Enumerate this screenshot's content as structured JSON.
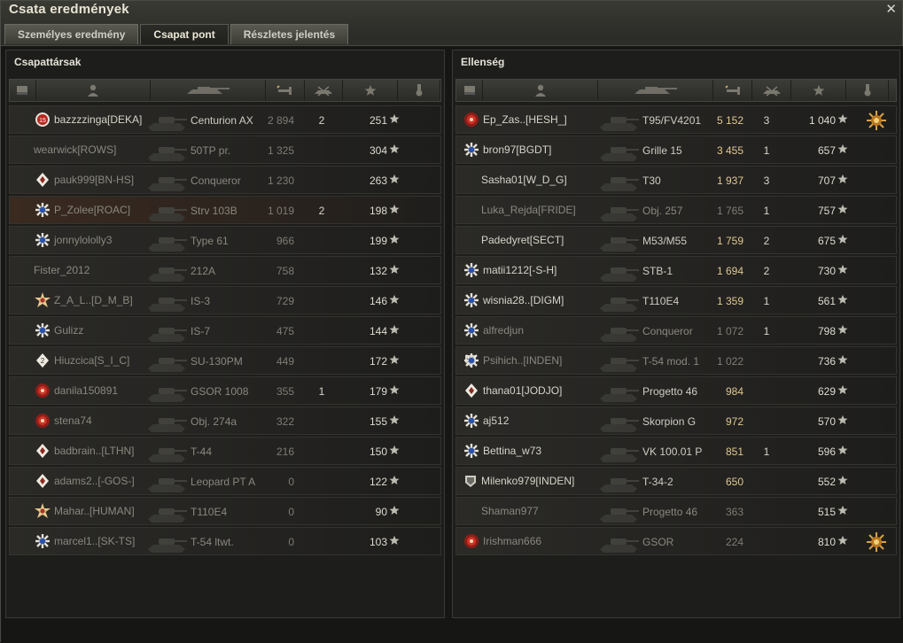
{
  "window": {
    "title": "Csata eredmények",
    "close_glyph": "✕"
  },
  "tabs": [
    {
      "label": "Személyes eredmény",
      "active": false
    },
    {
      "label": "Csapat pont",
      "active": true
    },
    {
      "label": "Részletes jelentés",
      "active": false
    }
  ],
  "allies": {
    "title": "Csapattársak",
    "rows": [
      {
        "badge": "rank-15-icon",
        "name": "bazzzzinga[DEKA]",
        "vehicle": "Centurion AX",
        "damage": "2 894",
        "kills": "2",
        "xp": "251",
        "dead": false,
        "hl": false
      },
      {
        "badge": "",
        "name": "wearwick[ROWS]",
        "vehicle": "50TP pr.",
        "damage": "1 325",
        "kills": "",
        "xp": "304",
        "dead": true,
        "hl": false
      },
      {
        "badge": "rank-diamond-icon",
        "name": "pauk999[BN-HS]",
        "vehicle": "Conqueror",
        "damage": "1 230",
        "kills": "",
        "xp": "263",
        "dead": true,
        "hl": false
      },
      {
        "badge": "rank-snowflake-icon",
        "name": "P_Zolee[ROAC]",
        "vehicle": "Strv 103B",
        "damage": "1 019",
        "kills": "2",
        "xp": "198",
        "dead": true,
        "hl": true
      },
      {
        "badge": "rank-snowflake-icon",
        "name": "jonnylololly3",
        "vehicle": "Type 61",
        "damage": "966",
        "kills": "",
        "xp": "199",
        "dead": true,
        "hl": false
      },
      {
        "badge": "",
        "name": "Fister_2012",
        "vehicle": "212A",
        "damage": "758",
        "kills": "",
        "xp": "132",
        "dead": true,
        "hl": false
      },
      {
        "badge": "rank-star-icon",
        "name": "Z_A_L..[D_M_B]",
        "vehicle": "IS-3",
        "damage": "729",
        "kills": "",
        "xp": "146",
        "dead": true,
        "hl": false
      },
      {
        "badge": "rank-snowflake-icon",
        "name": "Gulizz",
        "vehicle": "IS-7",
        "damage": "475",
        "kills": "",
        "xp": "144",
        "dead": true,
        "hl": false
      },
      {
        "badge": "rank-2-icon",
        "name": "Hiuzcica[S_I_C]",
        "vehicle": "SU-130PM",
        "damage": "449",
        "kills": "",
        "xp": "172",
        "dead": true,
        "hl": false
      },
      {
        "badge": "rank-red-icon",
        "name": "danila150891",
        "vehicle": "GSOR 1008",
        "damage": "355",
        "kills": "1",
        "xp": "179",
        "dead": true,
        "hl": false
      },
      {
        "badge": "rank-red-icon",
        "name": "stena74",
        "vehicle": "Obj. 274a",
        "damage": "322",
        "kills": "",
        "xp": "155",
        "dead": true,
        "hl": false
      },
      {
        "badge": "rank-diamond-icon",
        "name": "badbrain..[LTHN]",
        "vehicle": "T-44",
        "damage": "216",
        "kills": "",
        "xp": "150",
        "dead": true,
        "hl": false
      },
      {
        "badge": "rank-diamond-icon",
        "name": "adams2..[-GOS-]",
        "vehicle": "Leopard PT A",
        "damage": "0",
        "kills": "",
        "xp": "122",
        "dead": true,
        "hl": false
      },
      {
        "badge": "rank-star-icon",
        "name": "Mahar..[HUMAN]",
        "vehicle": "T110E4",
        "damage": "0",
        "kills": "",
        "xp": "90",
        "dead": true,
        "hl": false
      },
      {
        "badge": "rank-snowflake-icon",
        "name": "marcel1..[SK-TS]",
        "vehicle": "T-54 ltwt.",
        "damage": "0",
        "kills": "",
        "xp": "103",
        "dead": true,
        "hl": false
      }
    ]
  },
  "enemies": {
    "title": "Ellenség",
    "rows": [
      {
        "badge": "rank-red-icon",
        "name": "Ep_Zas..[HESH_]",
        "vehicle": "T95/FV4201",
        "damage": "5 152",
        "kills": "3",
        "xp": "1 040",
        "medal": true,
        "dead": false,
        "gold": true,
        "platoon": false
      },
      {
        "badge": "rank-snowflake-icon",
        "name": "bron97[BGDT]",
        "vehicle": "Grille 15",
        "damage": "3 455",
        "kills": "1",
        "xp": "657",
        "medal": false,
        "dead": false,
        "gold": true,
        "platoon": false
      },
      {
        "badge": "",
        "name": "Sasha01[W_D_G]",
        "vehicle": "T30",
        "damage": "1 937",
        "kills": "3",
        "xp": "707",
        "medal": false,
        "dead": false,
        "gold": true,
        "platoon": false
      },
      {
        "badge": "",
        "name": "Luka_Rejda[FRIDE]",
        "vehicle": "Obj. 257",
        "damage": "1 765",
        "kills": "1",
        "xp": "757",
        "medal": false,
        "dead": true,
        "gold": false,
        "platoon": false
      },
      {
        "badge": "",
        "name": "Padedyret[SECT]",
        "vehicle": "M53/M55",
        "damage": "1 759",
        "kills": "2",
        "xp": "675",
        "medal": false,
        "dead": false,
        "gold": true,
        "platoon": false
      },
      {
        "badge": "rank-snowflake-icon",
        "name": "matii1212[-S-H]",
        "vehicle": "STB-1",
        "damage": "1 694",
        "kills": "2",
        "xp": "730",
        "medal": false,
        "dead": false,
        "gold": true,
        "platoon": false
      },
      {
        "badge": "rank-snowflake-icon",
        "name": "wisnia28..[DIGM]",
        "vehicle": "T110E4",
        "damage": "1 359",
        "kills": "1",
        "xp": "561",
        "medal": false,
        "dead": false,
        "gold": true,
        "platoon": false
      },
      {
        "badge": "rank-snowflake-icon",
        "name": "alfredjun",
        "vehicle": "Conqueror",
        "damage": "1 072",
        "kills": "1",
        "xp": "798",
        "medal": false,
        "dead": true,
        "gold": false,
        "platoon": false
      },
      {
        "badge": "rank-snowflake-icon",
        "name": "Psihich..[INDEN]",
        "vehicle": "T-54 mod. 1",
        "damage": "1 022",
        "kills": "",
        "xp": "736",
        "medal": false,
        "dead": true,
        "gold": false,
        "platoon": true
      },
      {
        "badge": "rank-diamond-icon",
        "name": "thana01[JODJO]",
        "vehicle": "Progetto 46",
        "damage": "984",
        "kills": "",
        "xp": "629",
        "medal": false,
        "dead": false,
        "gold": true,
        "platoon": false
      },
      {
        "badge": "rank-snowflake-icon",
        "name": "aj512",
        "vehicle": "Skorpion G",
        "damage": "972",
        "kills": "",
        "xp": "570",
        "medal": false,
        "dead": false,
        "gold": true,
        "platoon": false
      },
      {
        "badge": "rank-snowflake-icon",
        "name": "Bettina_w73",
        "vehicle": "VK 100.01 P",
        "damage": "851",
        "kills": "1",
        "xp": "596",
        "medal": false,
        "dead": false,
        "gold": true,
        "platoon": false
      },
      {
        "badge": "",
        "name": "Milenko979[INDEN]",
        "vehicle": "T-34-2",
        "damage": "650",
        "kills": "",
        "xp": "552",
        "medal": false,
        "dead": false,
        "gold": true,
        "platoon": true
      },
      {
        "badge": "",
        "name": "Shaman977",
        "vehicle": "Progetto 46",
        "damage": "363",
        "kills": "",
        "xp": "515",
        "medal": false,
        "dead": true,
        "gold": false,
        "platoon": false
      },
      {
        "badge": "rank-red-icon",
        "name": "Irishman666",
        "vehicle": "GSOR",
        "damage": "224",
        "kills": "",
        "xp": "810",
        "medal": true,
        "dead": true,
        "gold": false,
        "platoon": false
      }
    ]
  },
  "colors": {
    "gold": "#e0c890",
    "dim": "#7e7c74",
    "text": "#d6d4c8"
  }
}
